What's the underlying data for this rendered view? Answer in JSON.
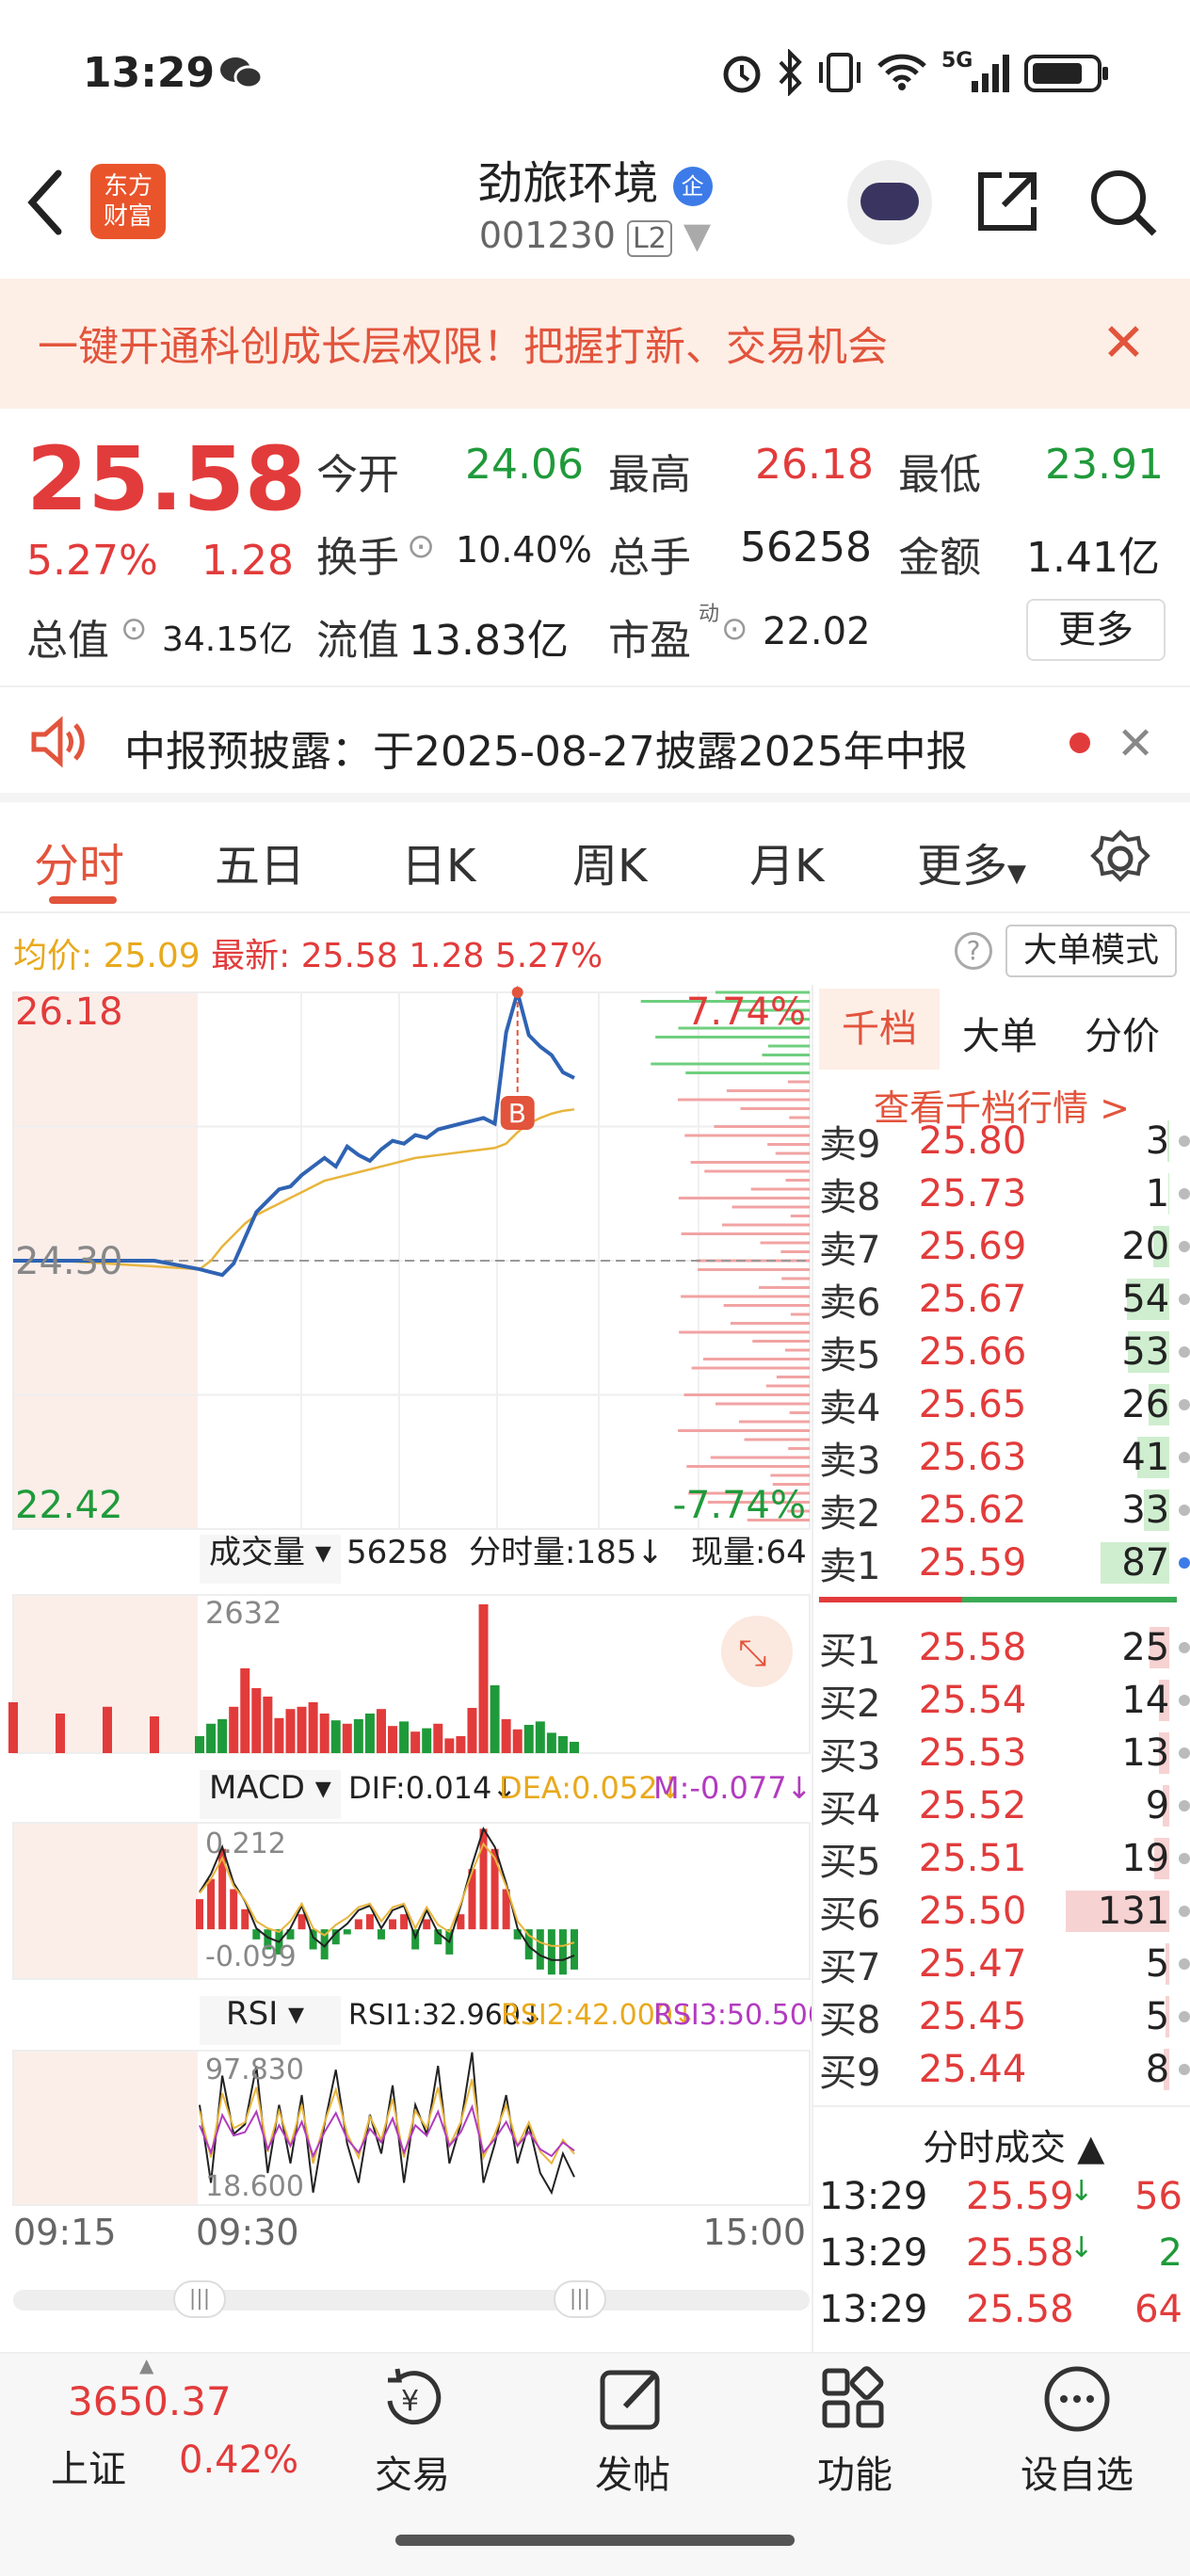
{
  "status_bar": {
    "time": "13:29",
    "network": "5G"
  },
  "header": {
    "title": "劲旅环境",
    "badge": "企",
    "code": "001230",
    "level": "L2",
    "brand_line1": "东方",
    "brand_line2": "财富"
  },
  "banner": {
    "text": "一键开通科创成长层权限！把握打新、交易机会"
  },
  "quote": {
    "price": "25.58",
    "change_pct": "5.27%",
    "change": "1.28",
    "open_label": "今开",
    "open": "24.06",
    "high_label": "最高",
    "high": "26.18",
    "low_label": "最低",
    "low": "23.91",
    "turnover_label": "换手",
    "turnover": "10.40%",
    "volume_label": "总手",
    "volume": "56258",
    "amount_label": "金额",
    "amount": "1.41亿",
    "mktcap_label": "总值",
    "mktcap": "34.15亿",
    "float_label": "流值",
    "float": "13.83亿",
    "pe_label": "市盈",
    "pe_sup": "动",
    "pe": "22.02",
    "more": "更多"
  },
  "notice": {
    "text": "中报预披露：于2025-08-27披露2025年中报"
  },
  "tabs": [
    "分时",
    "五日",
    "日K",
    "周K",
    "月K",
    "更多"
  ],
  "info_line": {
    "avg_label": "均价:",
    "avg": "25.09",
    "last_label": "最新:",
    "last": "25.58",
    "chg": "1.28",
    "pct": "5.27%",
    "mode": "大单模式"
  },
  "chart_data": {
    "type": "line",
    "title": "",
    "y_max": "26.18",
    "y_min": "22.42",
    "y_ref": "24.30",
    "pct_up": "7.74%",
    "pct_down": "-7.74%",
    "x_ticks": [
      "09:15",
      "09:30",
      "15:00"
    ],
    "price": [
      24.3,
      24.3,
      24.3,
      24.3,
      24.24,
      24.22,
      24.2,
      24.28,
      24.46,
      24.64,
      24.72,
      24.8,
      24.82,
      24.9,
      24.96,
      25.02,
      24.96,
      25.1,
      25.04,
      25.0,
      25.08,
      25.14,
      25.12,
      25.18,
      25.16,
      25.22,
      25.24,
      25.26,
      25.28,
      25.3,
      25.26,
      25.9,
      26.18,
      25.88,
      25.8,
      25.74,
      25.62,
      25.58
    ],
    "avg": [
      24.3,
      24.3,
      24.28,
      24.26,
      24.24,
      24.3,
      24.4,
      24.48,
      24.56,
      24.62,
      24.66,
      24.7,
      24.74,
      24.78,
      24.82,
      24.86,
      24.88,
      24.9,
      24.92,
      24.94,
      24.96,
      24.98,
      25.0,
      25.02,
      25.03,
      25.04,
      25.05,
      25.06,
      25.07,
      25.08,
      25.09,
      25.12,
      25.2,
      25.26,
      25.3,
      25.33,
      25.35,
      25.36
    ],
    "volume_label": "成交量",
    "volume_total": "56258",
    "tick_vol_label": "分时量:185",
    "now_vol_label": "现量:64",
    "vol_max": "2632",
    "volume": [
      900,
      700,
      820,
      650,
      300,
      520,
      600,
      820,
      1500,
      1150,
      1000,
      620,
      780,
      820,
      900,
      700,
      580,
      520,
      600,
      700,
      780,
      480,
      560,
      380,
      440,
      520,
      260,
      300,
      800,
      2632,
      1200,
      600,
      420,
      500,
      560,
      360,
      300,
      200
    ],
    "macd_label": "MACD",
    "dif": "DIF:0.014",
    "dea": "DEA:0.052",
    "m": "M:-0.077",
    "macd_max": "0.212",
    "macd_min": "-0.099",
    "macd": [
      0,
      0,
      0,
      0,
      0.06,
      0.1,
      0.16,
      0.08,
      0.04,
      -0.02,
      -0.04,
      -0.05,
      -0.02,
      0.03,
      -0.04,
      -0.06,
      -0.03,
      -0.01,
      0.02,
      0.03,
      -0.02,
      0.02,
      0.03,
      -0.04,
      0.02,
      -0.03,
      -0.05,
      0.03,
      0.12,
      0.2,
      0.16,
      0.08,
      -0.02,
      -0.06,
      -0.08,
      -0.09,
      -0.09,
      -0.08
    ],
    "rsi_label": "RSI",
    "rsi1": "RSI1:32.960",
    "rsi2": "RSI2:42.000",
    "rsi3": "RSI3:50.500",
    "rsi_max": "97.830",
    "rsi_min": "18.600",
    "rsi": [
      80,
      60,
      95,
      40,
      70,
      30,
      85,
      55,
      60,
      90,
      35,
      70,
      40,
      75,
      25,
      60,
      88,
      50,
      30,
      65,
      45,
      80,
      30,
      70,
      55,
      90,
      40,
      60,
      97,
      30,
      50,
      75,
      40,
      60,
      35,
      25,
      45,
      33
    ]
  },
  "order_book": {
    "tabs": [
      "千档",
      "大单",
      "分价"
    ],
    "link": "查看千档行情 >",
    "sells": [
      {
        "label": "卖9",
        "price": "25.80",
        "vol": "3"
      },
      {
        "label": "卖8",
        "price": "25.73",
        "vol": "1"
      },
      {
        "label": "卖7",
        "price": "25.69",
        "vol": "20"
      },
      {
        "label": "卖6",
        "price": "25.67",
        "vol": "54"
      },
      {
        "label": "卖5",
        "price": "25.66",
        "vol": "53"
      },
      {
        "label": "卖4",
        "price": "25.65",
        "vol": "26"
      },
      {
        "label": "卖3",
        "price": "25.63",
        "vol": "41"
      },
      {
        "label": "卖2",
        "price": "25.62",
        "vol": "33"
      },
      {
        "label": "卖1",
        "price": "25.59",
        "vol": "87"
      }
    ],
    "buys": [
      {
        "label": "买1",
        "price": "25.58",
        "vol": "25"
      },
      {
        "label": "买2",
        "price": "25.54",
        "vol": "14"
      },
      {
        "label": "买3",
        "price": "25.53",
        "vol": "13"
      },
      {
        "label": "买4",
        "price": "25.52",
        "vol": "9"
      },
      {
        "label": "买5",
        "price": "25.51",
        "vol": "19"
      },
      {
        "label": "买6",
        "price": "25.50",
        "vol": "131"
      },
      {
        "label": "买7",
        "price": "25.47",
        "vol": "5"
      },
      {
        "label": "买8",
        "price": "25.45",
        "vol": "5"
      },
      {
        "label": "买9",
        "price": "25.44",
        "vol": "8"
      }
    ],
    "ticks_title": "分时成交",
    "ticks": [
      {
        "time": "13:29",
        "price": "25.59",
        "vol": "56"
      },
      {
        "time": "13:29",
        "price": "25.58",
        "vol": "2"
      },
      {
        "time": "13:29",
        "price": "25.58",
        "vol": "64"
      }
    ]
  },
  "bottom_nav": {
    "index_value": "3650.37",
    "index_name": "上证",
    "index_pct": "0.42%",
    "items": [
      "交易",
      "发帖",
      "功能",
      "设自选"
    ]
  }
}
